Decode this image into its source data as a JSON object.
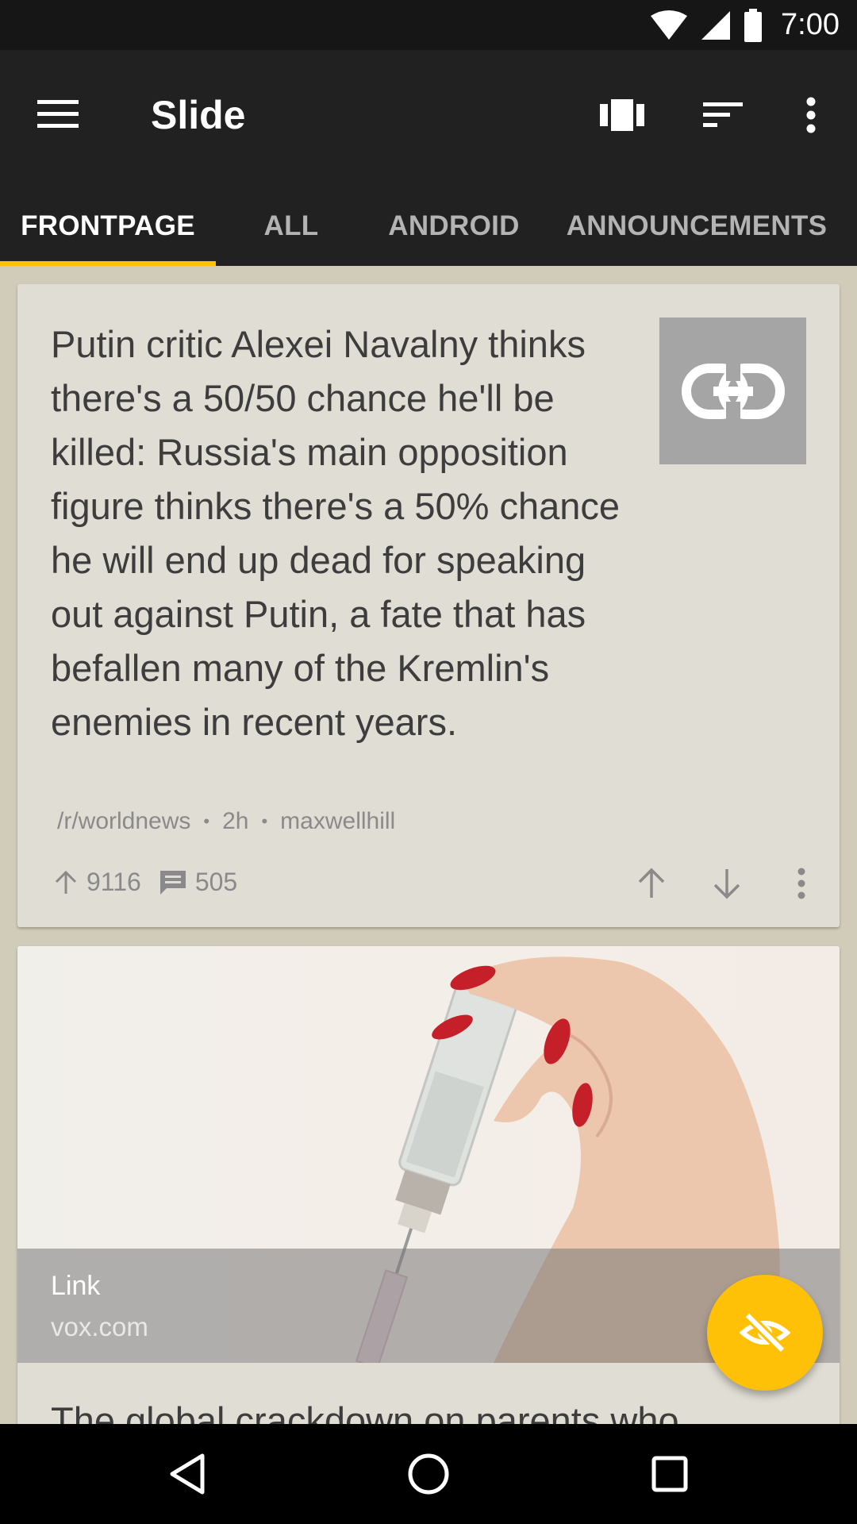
{
  "status_bar": {
    "time": "7:00"
  },
  "app_bar": {
    "title": "Slide",
    "tabs": [
      {
        "label": "FRONTPAGE",
        "active": true
      },
      {
        "label": "ALL",
        "active": false
      },
      {
        "label": "ANDROID",
        "active": false
      },
      {
        "label": "ANNOUNCEMENTS",
        "active": false
      }
    ],
    "accent_color": "#ffc107"
  },
  "posts": [
    {
      "title": "Putin critic Alexei Navalny thinks there's a 50/50 chance he'll be killed: Russia's main opposition figure thinks there's a 50% chance he will end up dead for speaking out against Putin, a fate that has befallen many of the Kremlin's enemies in recent years.",
      "subreddit": "/r/worldnews",
      "age": "2h",
      "author": "maxwellhill",
      "score": "9116",
      "comments": "505",
      "thumbnail_icon": "link-icon"
    },
    {
      "link_type": "Link",
      "domain": "vox.com",
      "title_partial": "The global crackdown on parents who"
    }
  ]
}
